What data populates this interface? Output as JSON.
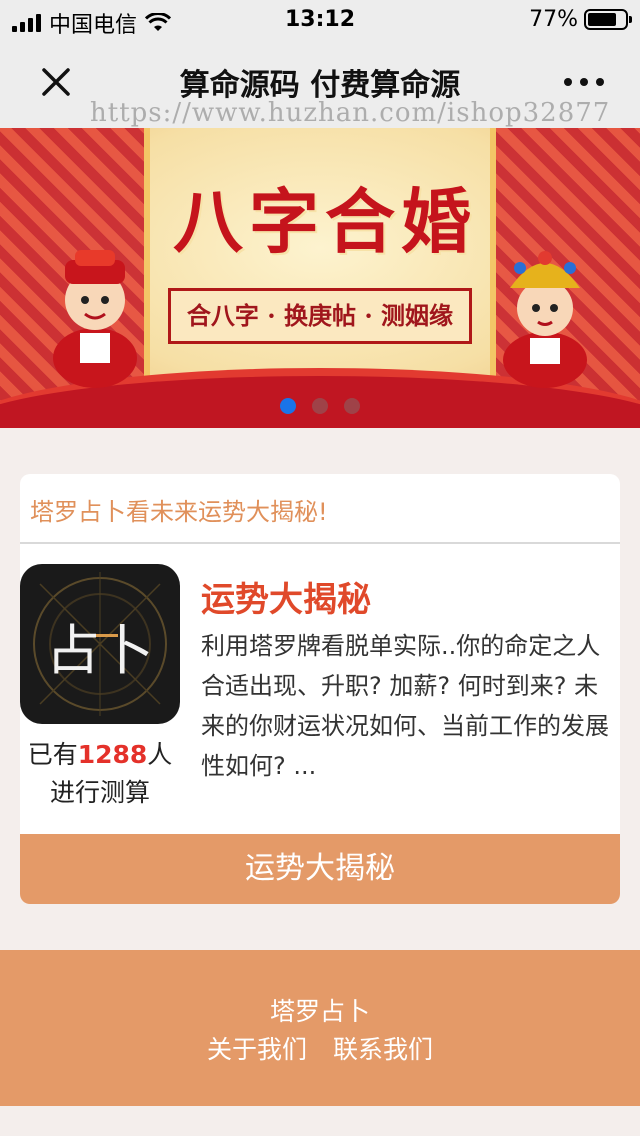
{
  "status_bar": {
    "carrier": "中国电信",
    "time": "13:12",
    "battery": "77%",
    "battery_level": 0.77,
    "icons": [
      "signal-icon",
      "wifi-icon",
      "battery-icon"
    ]
  },
  "nav": {
    "title": "算命源码 付费算命源",
    "close_icon": "close-icon",
    "more_icon": "more-icon",
    "watermark": "https://www.huzhan.com/ishop32877"
  },
  "banner": {
    "title": "八字合婚",
    "subtitle": "合八字 · 换庚帖 · 测姻缘",
    "slide_count": 3,
    "active_slide": 0
  },
  "card": {
    "header": "塔罗占卜看未来运势大揭秘!",
    "app_name": "运势大揭秘",
    "description": "利用塔罗牌看脱单实际..你的命定之人合适出现、升职? 加薪? 何时到来? 未来的你财运状况如何、当前工作的发展性如何? ...",
    "count_prefix": "已有",
    "count_value": "1288",
    "count_suffix": "人",
    "count_line2": "进行测算",
    "logo_text": "占卜",
    "button_label": "运势大揭秘"
  },
  "footer": {
    "name": "塔罗占卜",
    "links": [
      "关于我们",
      "联系我们"
    ]
  },
  "colors": {
    "accent": "#e49a68",
    "highlight": "#e4312a",
    "title_red": "#e0492a",
    "header_orange": "#e0905a",
    "dot_active": "#1a74e8"
  }
}
